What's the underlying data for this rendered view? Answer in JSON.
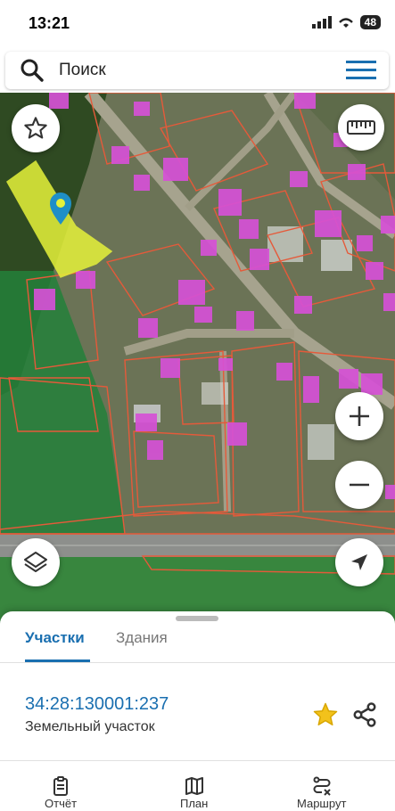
{
  "status": {
    "time": "13:21",
    "battery": "48"
  },
  "search": {
    "label": "Поиск"
  },
  "map": {
    "parcel_color": "#e6f23a",
    "building_color": "#d651d6",
    "boundary_color": "#e55a3a",
    "pin_color": "#1f8fc7"
  },
  "sheet": {
    "tabs": [
      {
        "label": "Участки",
        "active": true
      },
      {
        "label": "Здания",
        "active": false
      }
    ],
    "cadastral_number": "34:28:130001:237",
    "object_type": "Земельный участок"
  },
  "bottom_nav": [
    {
      "label": "Отчёт",
      "icon": "clipboard-icon"
    },
    {
      "label": "План",
      "icon": "map-icon"
    },
    {
      "label": "Маршрут",
      "icon": "route-icon"
    }
  ]
}
